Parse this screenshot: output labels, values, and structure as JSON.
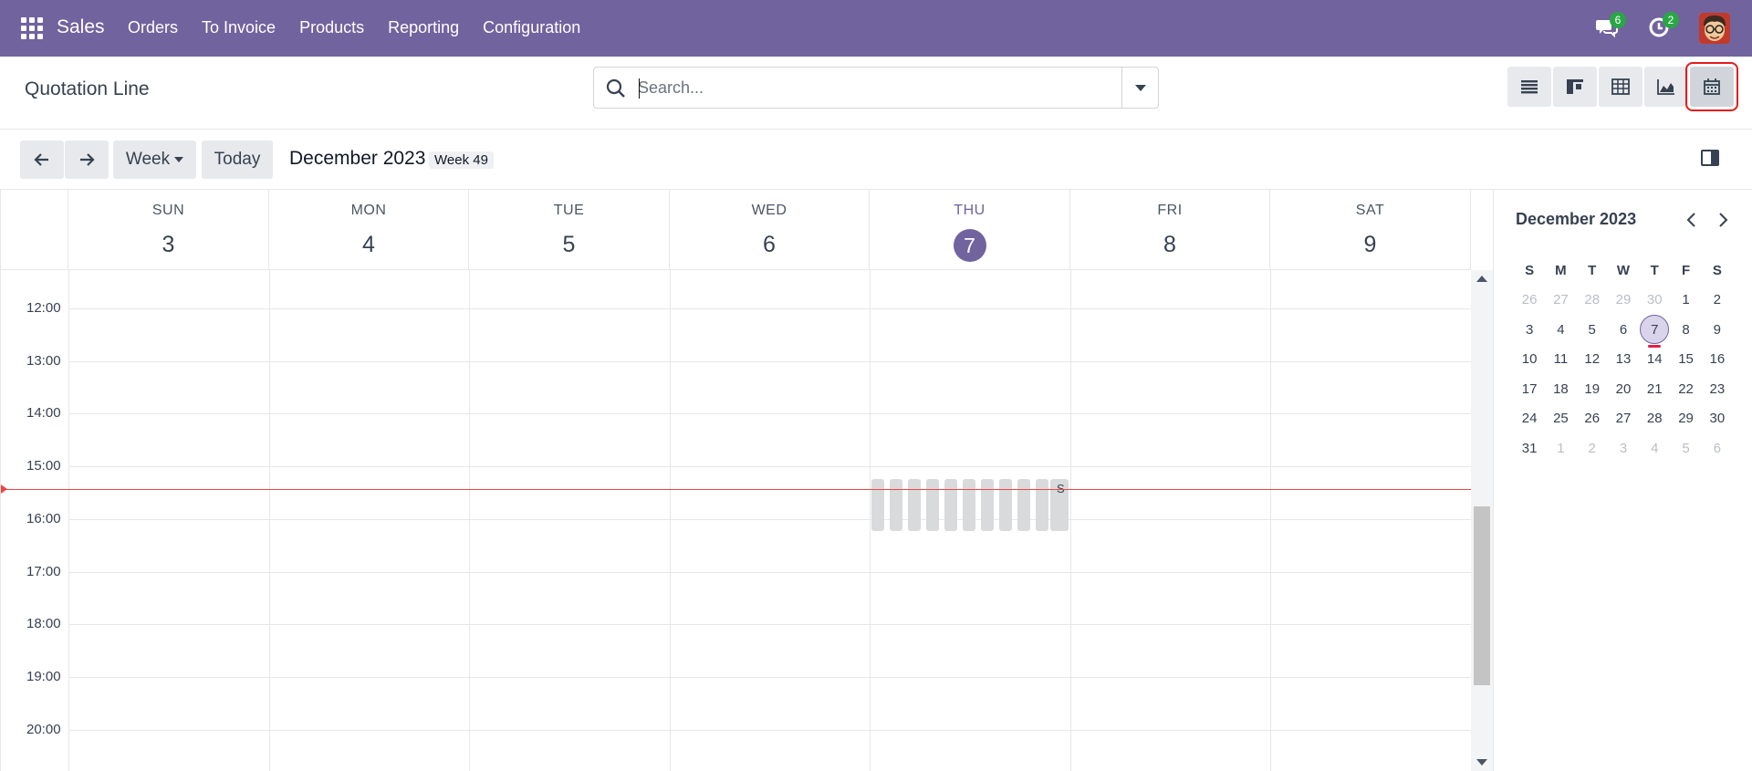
{
  "navbar": {
    "brand": "Sales",
    "menu": [
      "Orders",
      "To Invoice",
      "Products",
      "Reporting",
      "Configuration"
    ],
    "messages_count": "6",
    "activities_count": "2",
    "accent": "#71639e"
  },
  "control": {
    "title": "Quotation Line",
    "search_placeholder": "Search...",
    "views": [
      "list-icon",
      "kanban-icon",
      "pivot-icon",
      "graph-icon",
      "calendar-icon"
    ],
    "active_view": "calendar-icon"
  },
  "toolbar": {
    "prev_icon": "arrow-left-icon",
    "next_icon": "arrow-right-icon",
    "scale_label": "Week",
    "today_label": "Today",
    "period_title": "December 2023",
    "week_label": "Week 49"
  },
  "week": {
    "days": [
      {
        "dow": "SUN",
        "num": "3"
      },
      {
        "dow": "MON",
        "num": "4"
      },
      {
        "dow": "TUE",
        "num": "5"
      },
      {
        "dow": "WED",
        "num": "6"
      },
      {
        "dow": "THU",
        "num": "7",
        "today": true
      },
      {
        "dow": "FRI",
        "num": "8"
      },
      {
        "dow": "SAT",
        "num": "9"
      }
    ],
    "hours": [
      "12:00",
      "13:00",
      "14:00",
      "15:00",
      "16:00",
      "17:00",
      "18:00",
      "19:00",
      "20:00"
    ],
    "event_label": "S",
    "event_count": 11
  },
  "mini_calendar": {
    "title": "December 2023",
    "weekdays": [
      "S",
      "M",
      "T",
      "W",
      "T",
      "F",
      "S"
    ],
    "weeks": [
      [
        "26",
        "27",
        "28",
        "29",
        "30",
        "1",
        "2"
      ],
      [
        "3",
        "4",
        "5",
        "6",
        "7",
        "8",
        "9"
      ],
      [
        "10",
        "11",
        "12",
        "13",
        "14",
        "15",
        "16"
      ],
      [
        "17",
        "18",
        "19",
        "20",
        "21",
        "22",
        "23"
      ],
      [
        "24",
        "25",
        "26",
        "27",
        "28",
        "29",
        "30"
      ],
      [
        "31",
        "1",
        "2",
        "3",
        "4",
        "5",
        "6"
      ]
    ],
    "today": "7"
  }
}
